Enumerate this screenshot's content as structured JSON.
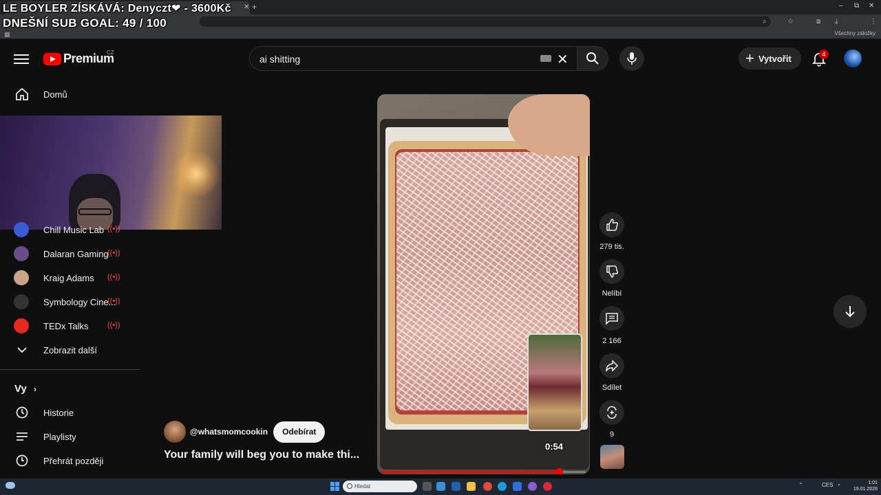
{
  "overlay": {
    "line1": "LE BOYLER ZÍSKÁVÁ: Denyczt❤ - 3600Kč",
    "line2": "DNEŠNÍ SUB GOAL: 49 / 100"
  },
  "browser": {
    "bookmarks_right": "Všechny záložky"
  },
  "masthead": {
    "logo_text": "Premium",
    "country_code": "CZ",
    "search_value": "ai shitting",
    "create_label": "Vytvořit",
    "notification_count": "4"
  },
  "sidebar": {
    "home_label": "Domů",
    "subscriptions": [
      {
        "name": "Chill Music Lab",
        "color": "#3a5bd9"
      },
      {
        "name": "Dalaran Gaming",
        "color": "#6a4c8a"
      },
      {
        "name": "Kraig Adams",
        "color": "#c9a38a"
      },
      {
        "name": "Symbology Cine...",
        "color": "#333333"
      },
      {
        "name": "TEDx Talks",
        "color": "#e62b1e"
      }
    ],
    "show_more_label": "Zobrazit další",
    "you_heading": "Vy",
    "you_items": [
      {
        "label": "Historie",
        "icon": "history-icon"
      },
      {
        "label": "Playlisty",
        "icon": "playlist-icon"
      },
      {
        "label": "Přehrát později",
        "icon": "watch-later-icon"
      }
    ]
  },
  "short": {
    "time": "0:54",
    "progress": 0.87,
    "channel_handle": "@whatsmomcookin",
    "subscribe_label": "Odebírat",
    "title": "Your family will beg you to make thi..."
  },
  "actions": {
    "like_count": "279 tis.",
    "dislike_label": "Nelíbí",
    "comment_count": "2 166",
    "share_label": "Sdílet",
    "remix_count": "9"
  },
  "taskbar": {
    "search_placeholder": "Hledat",
    "lang": "CES",
    "time": "1:01",
    "date": "19.01.2026"
  },
  "colors": {
    "accent": "#ff0000",
    "background": "#0f0f0f",
    "chip": "#272727"
  }
}
